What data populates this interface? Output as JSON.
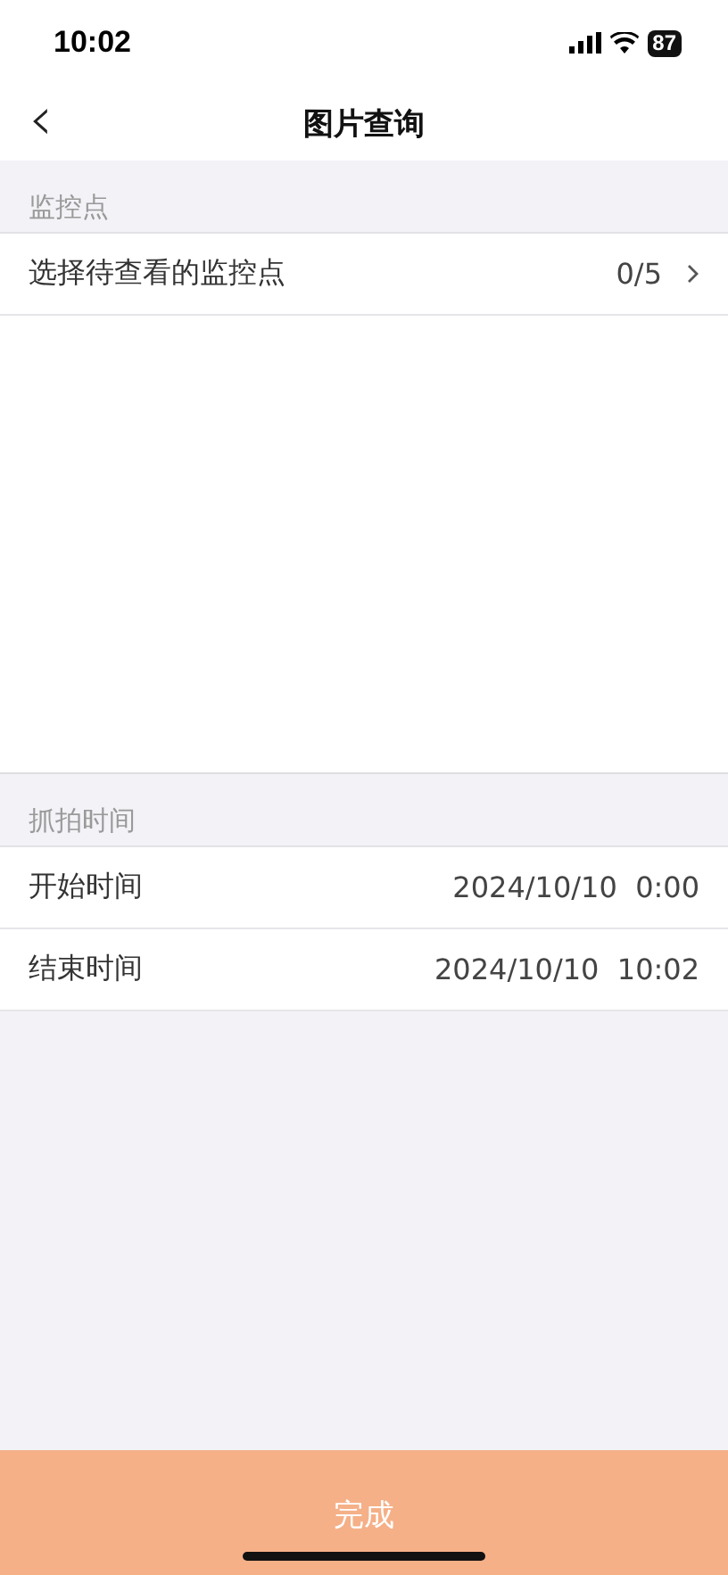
{
  "status_bar": {
    "time": "10:02",
    "battery": "87"
  },
  "nav_bar": {
    "back": "‹",
    "title": "图片查询"
  },
  "sections": [
    {
      "header": "监控点",
      "rows": [
        {
          "label": "选择待查看的监控点",
          "value": "0/5",
          "chevron": true
        }
      ],
      "kind": "picker"
    },
    {
      "header": "抓拍时间",
      "rows": [
        {
          "label": "开始时间",
          "value": "2024/10/10  0:00",
          "chevron": false
        },
        {
          "label": "结束时间",
          "value": "2024/10/10  10:02",
          "chevron": false
        }
      ],
      "kind": "times"
    }
  ],
  "done_button": {
    "label": "完成",
    "disabled": true
  }
}
